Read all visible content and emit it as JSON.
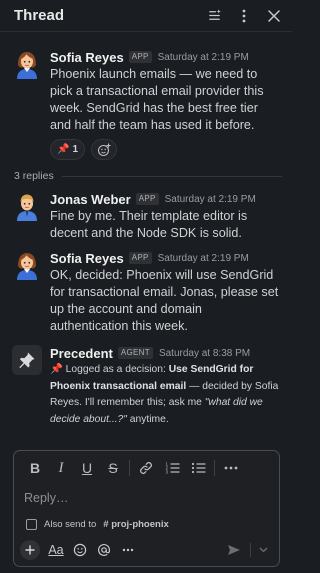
{
  "header": {
    "title": "Thread"
  },
  "messages": [
    {
      "author": "Sofia Reyes",
      "tag": "APP",
      "time": "Saturday at 2:19 PM",
      "text": "Phoenix launch emails — we need to pick a transactional email provider this week. SendGrid has the best free tier and half the team has used it before.",
      "reactions": [
        {
          "emoji": "📌",
          "count": "1"
        }
      ]
    },
    {
      "author": "Jonas Weber",
      "tag": "APP",
      "time": "Saturday at 2:19 PM",
      "text": "Fine by me. Their template editor is decent and the Node SDK is solid."
    },
    {
      "author": "Sofia Reyes",
      "tag": "APP",
      "time": "Saturday at 2:19 PM",
      "text": "OK, decided: Phoenix will use SendGrid for transactional email. Jonas, please set up the account and domain authentication this week."
    },
    {
      "author": "Precedent",
      "tag": "AGENT",
      "time": "Saturday at 8:38 PM",
      "text_prefix": "📌 Logged as a decision: ",
      "text_bold": "Use SendGrid for Phoenix transactional email",
      "text_middle": " — decided by Sofia Reyes. I'll remember this; ask me ",
      "text_italic": "\"what did we decide about...?\"",
      "text_suffix": " anytime."
    }
  ],
  "replies_label": "3 replies",
  "composer": {
    "placeholder": "Reply…",
    "also_send_label": "Also send to",
    "channel": "# proj-phoenix",
    "format_label": "Aa"
  },
  "icons": {
    "header": [
      "filter-icon",
      "more-vertical-icon",
      "close-icon"
    ],
    "toolbar": [
      "bold-icon",
      "italic-icon",
      "underline-icon",
      "strikethrough-icon",
      "link-icon",
      "ordered-list-icon",
      "bulleted-list-icon",
      "more-horizontal-icon"
    ],
    "bottom": [
      "plus-icon",
      "format-icon",
      "emoji-icon",
      "mention-icon",
      "more-horizontal-icon",
      "send-icon",
      "chevron-down-icon"
    ]
  }
}
